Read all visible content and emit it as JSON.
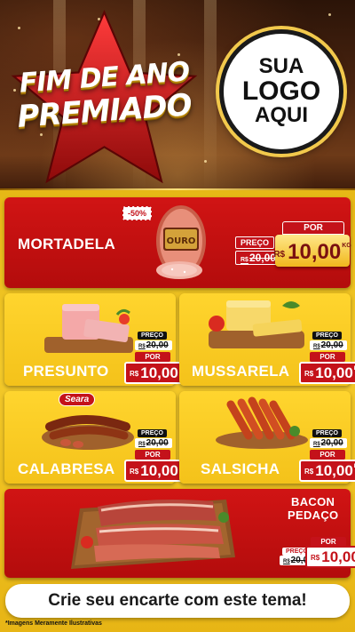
{
  "header": {
    "headline_line1": "FIM DE ANO",
    "headline_line2": "PREMIADO",
    "logo_line1": "SUA",
    "logo_line2": "LOGO",
    "logo_line3": "AQUI"
  },
  "colors": {
    "red": "#c4121a",
    "yellow": "#f4c21a",
    "gold": "#f2c94c"
  },
  "products": {
    "mortadela": {
      "name": "MORTADELA",
      "discount": "-50%",
      "brand_label": "OURO",
      "preco_label": "PREÇO",
      "old_currency": "R$",
      "old_price": "20,00",
      "por_label": "POR",
      "new_currency": "R$",
      "new_price": "10,00",
      "unit": "KG"
    },
    "presunto": {
      "name": "PRESUNTO",
      "preco_label": "PREÇO",
      "old_currency": "R$",
      "old_price": "20,00",
      "por_label": "POR",
      "new_currency": "R$",
      "new_price": "10,00",
      "unit": "KG"
    },
    "mussarela": {
      "name": "MUSSARELA",
      "preco_label": "PREÇO",
      "old_currency": "R$",
      "old_price": "20,00",
      "por_label": "POR",
      "new_currency": "R$",
      "new_price": "10,00",
      "unit": "KG"
    },
    "calabresa": {
      "name": "CALABRESA",
      "brand_label": "Seara",
      "preco_label": "PREÇO",
      "old_currency": "R$",
      "old_price": "20,00",
      "por_label": "POR",
      "new_currency": "R$",
      "new_price": "10,00",
      "unit": "KG"
    },
    "salsicha": {
      "name": "SALSICHA",
      "preco_label": "PREÇO",
      "old_currency": "R$",
      "old_price": "20,00",
      "por_label": "POR",
      "new_currency": "R$",
      "new_price": "10,00",
      "unit": "KG"
    },
    "bacon": {
      "name_line1": "BACON",
      "name_line2": "PEDAÇO",
      "preco_label": "PREÇO",
      "old_currency": "R$",
      "old_price": "20,00",
      "por_label": "POR",
      "new_currency": "R$",
      "new_price": "10,00",
      "unit": "KG"
    }
  },
  "footer": {
    "cta": "Crie seu encarte com este tema!",
    "disclaimer": "*Imagens Meramente Ilustrativas"
  }
}
